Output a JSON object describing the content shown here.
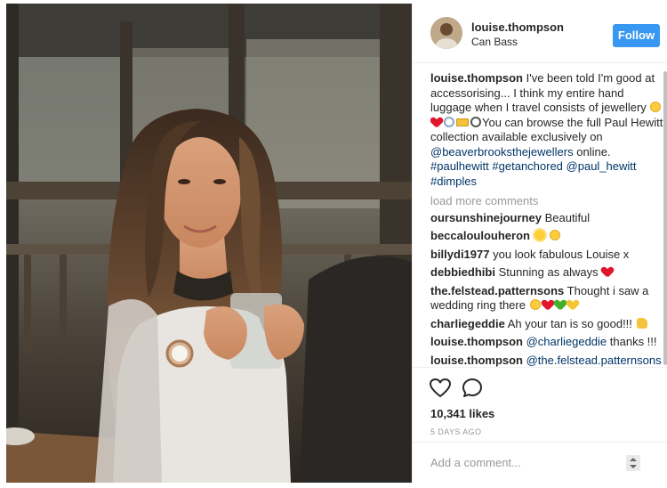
{
  "post": {
    "username": "louise.thompson",
    "location": "Can Bass",
    "follow_label": "Follow",
    "caption": {
      "username": "louise.thompson",
      "text_part1": " I've been told I'm good at accessorising... I think my entire hand luggage when I travel consists of jewellery ",
      "text_part2": "You can browse the full Paul Hewitt collection available exclusively on ",
      "mention1": "@beaverbrooksthejewellers",
      "text_part3": " online.",
      "hashtag1": "#paulhewitt",
      "hashtag2": "#getanchored",
      "mention2": "@paul_hewitt",
      "hashtag3": "#dimples"
    },
    "load_more": "load more comments",
    "comments": [
      {
        "user": "oursunshinejourney",
        "text": " Beautiful"
      },
      {
        "user": "beccaloulouheron",
        "text": " "
      },
      {
        "user": "billydi1977",
        "text": " you look fabulous Louise x"
      },
      {
        "user": "debbiedhibi",
        "text": " Stunning as always "
      },
      {
        "user": "the.felstead.patternsons",
        "text": " Thought i saw a wedding ring there "
      },
      {
        "user": "charliegeddie",
        "text": " Ah your tan is so good!!! "
      },
      {
        "user": "louise.thompson",
        "mention": " @charliegeddie",
        "text": " thanks !!!"
      },
      {
        "user": "louise.thompson",
        "mention": " @the.felstead.patternsons",
        "text": ""
      }
    ],
    "likes": "10,341 likes",
    "timestamp": "5 DAYS AGO",
    "add_comment_placeholder": "Add a comment..."
  },
  "icons": [
    "heart-outline-icon",
    "comment-bubble-icon",
    "more-options-icon"
  ],
  "colors": {
    "accent": "#3897f0",
    "link": "#003569",
    "muted": "#999999"
  }
}
